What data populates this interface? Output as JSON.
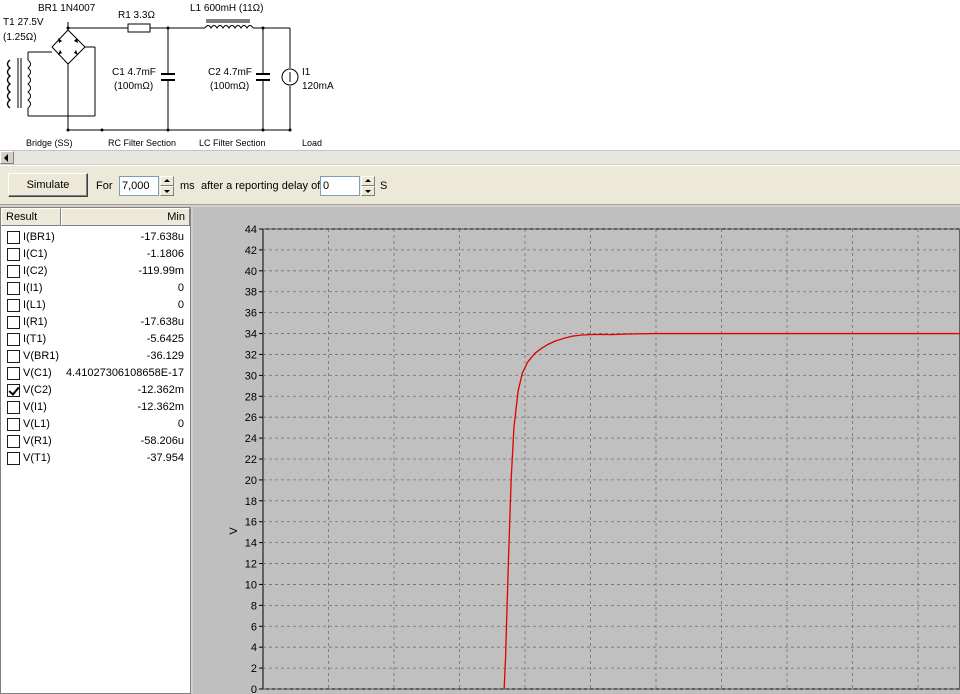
{
  "schematic": {
    "t1_label": "T1 27.5V",
    "t1_resistance": "(1.25Ω)",
    "br1_label": "BR1 1N4007",
    "r1_label": "R1 3.3Ω",
    "l1_label": "L1 600mH (11Ω)",
    "c1_label": "C1 4.7mF",
    "c1_esr": "(100mΩ)",
    "c2_label": "C2 4.7mF",
    "c2_esr": "(100mΩ)",
    "i1_label": "I1",
    "i1_value": "120mA",
    "sections": {
      "bridge": "Bridge (SS)",
      "rc": "RC Filter Section",
      "lc": "LC Filter Section",
      "load": "Load"
    }
  },
  "toolbar": {
    "simulate_label": "Simulate",
    "for_label": "For",
    "duration_value": "7,000",
    "duration_unit": "ms",
    "delay_label": "after a reporting delay of",
    "delay_value": "0",
    "delay_unit": "S"
  },
  "results": {
    "headers": {
      "result": "Result",
      "min": "Min"
    },
    "rows": [
      {
        "name": "I(BR1)",
        "min": "-17.638u",
        "checked": false
      },
      {
        "name": "I(C1)",
        "min": "-1.1806",
        "checked": false
      },
      {
        "name": "I(C2)",
        "min": "-119.99m",
        "checked": false
      },
      {
        "name": "I(I1)",
        "min": "0",
        "checked": false
      },
      {
        "name": "I(L1)",
        "min": "0",
        "checked": false
      },
      {
        "name": "I(R1)",
        "min": "-17.638u",
        "checked": false
      },
      {
        "name": "I(T1)",
        "min": "-5.6425",
        "checked": false
      },
      {
        "name": "V(BR1)",
        "min": "-36.129",
        "checked": false
      },
      {
        "name": "V(C1)",
        "min": "4.41027306108658E-17",
        "checked": false
      },
      {
        "name": "V(C2)",
        "min": "-12.362m",
        "checked": true
      },
      {
        "name": "V(I1)",
        "min": "-12.362m",
        "checked": false
      },
      {
        "name": "V(L1)",
        "min": "0",
        "checked": false
      },
      {
        "name": "V(R1)",
        "min": "-58.206u",
        "checked": false
      },
      {
        "name": "V(T1)",
        "min": "-37.954",
        "checked": false
      }
    ]
  },
  "chart_data": {
    "type": "line",
    "ylabel": "V",
    "ylim": [
      0,
      44
    ],
    "yticks": [
      "0",
      "2",
      "4",
      "6",
      "8",
      "10",
      "12",
      "14",
      "16",
      "18",
      "20",
      "22",
      "24",
      "26",
      "28",
      "30",
      "32",
      "34",
      "36",
      "38",
      "40",
      "42",
      "44"
    ],
    "grid": true,
    "series_color": "#e00000",
    "x_fraction_domain": [
      0,
      1
    ],
    "series": [
      {
        "x": [
          0.346,
          0.348,
          0.352,
          0.356,
          0.36,
          0.366,
          0.372,
          0.38,
          0.39,
          0.4,
          0.41,
          0.42,
          0.432,
          0.444,
          0.456,
          0.47,
          0.485,
          0.5,
          0.52,
          0.56,
          0.7,
          1.0
        ],
        "values": [
          0,
          3,
          12,
          20,
          25,
          28.5,
          30.2,
          31.3,
          32.1,
          32.6,
          33.0,
          33.3,
          33.55,
          33.75,
          33.85,
          33.9,
          33.92,
          33.9,
          33.95,
          34,
          34,
          34
        ]
      }
    ]
  }
}
